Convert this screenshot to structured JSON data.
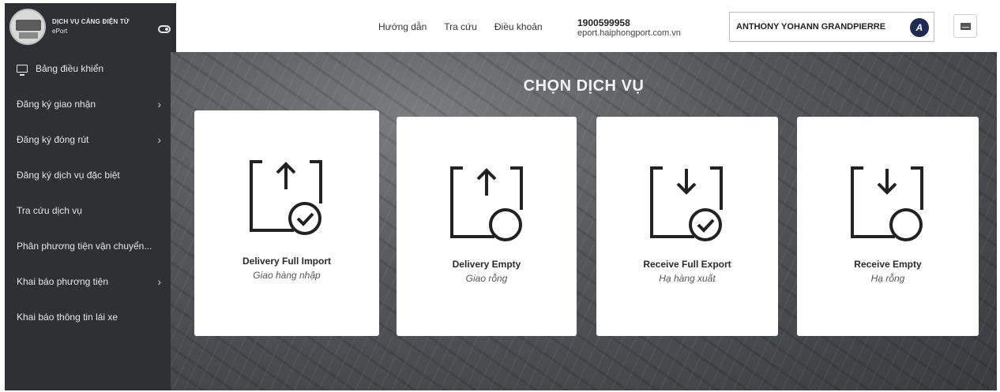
{
  "sidebar": {
    "brand_title": "DỊCH VỤ CẢNG ĐIỆN TỬ",
    "brand_subtitle": "ePort",
    "items": [
      {
        "label": "Bảng điều khiển",
        "icon": "monitor-icon"
      },
      {
        "label": "Đăng ký giao nhận",
        "has_submenu": true
      },
      {
        "label": "Đăng ký đóng rút",
        "has_submenu": true
      },
      {
        "label": "Đăng ký dịch vụ đặc biệt"
      },
      {
        "label": "Tra cứu dịch vụ"
      },
      {
        "label": "Phân phương tiện vận chuyển..."
      },
      {
        "label": "Khai báo phương tiện",
        "has_submenu": true
      },
      {
        "label": "Khai báo thông tin lái xe"
      }
    ]
  },
  "header": {
    "links": [
      "Hướng dẫn",
      "Tra cứu",
      "Điều khoản"
    ],
    "phone": "1900599958",
    "website": "eport.haiphongport.com.vn",
    "user_name": "ANTHONY YOHANN GRANDPIERRE",
    "avatar_letter": "A"
  },
  "main": {
    "title": "CHỌN DỊCH VỤ",
    "services": [
      {
        "label": "Delivery Full Import",
        "sublabel": "Giao hàng nhập",
        "arrow": "up",
        "badge": "check"
      },
      {
        "label": "Delivery Empty",
        "sublabel": "Giao rỗng",
        "arrow": "up",
        "badge": "empty"
      },
      {
        "label": "Receive Full Export",
        "sublabel": "Hạ hàng xuất",
        "arrow": "down",
        "badge": "check"
      },
      {
        "label": "Receive Empty",
        "sublabel": "Hạ rỗng",
        "arrow": "down",
        "badge": "empty"
      }
    ]
  },
  "colors": {
    "sidebar_bg": "#2f3033",
    "avatar_bg": "#1e2b55",
    "card_bg": "#ffffff",
    "icon_stroke": "#222222"
  }
}
